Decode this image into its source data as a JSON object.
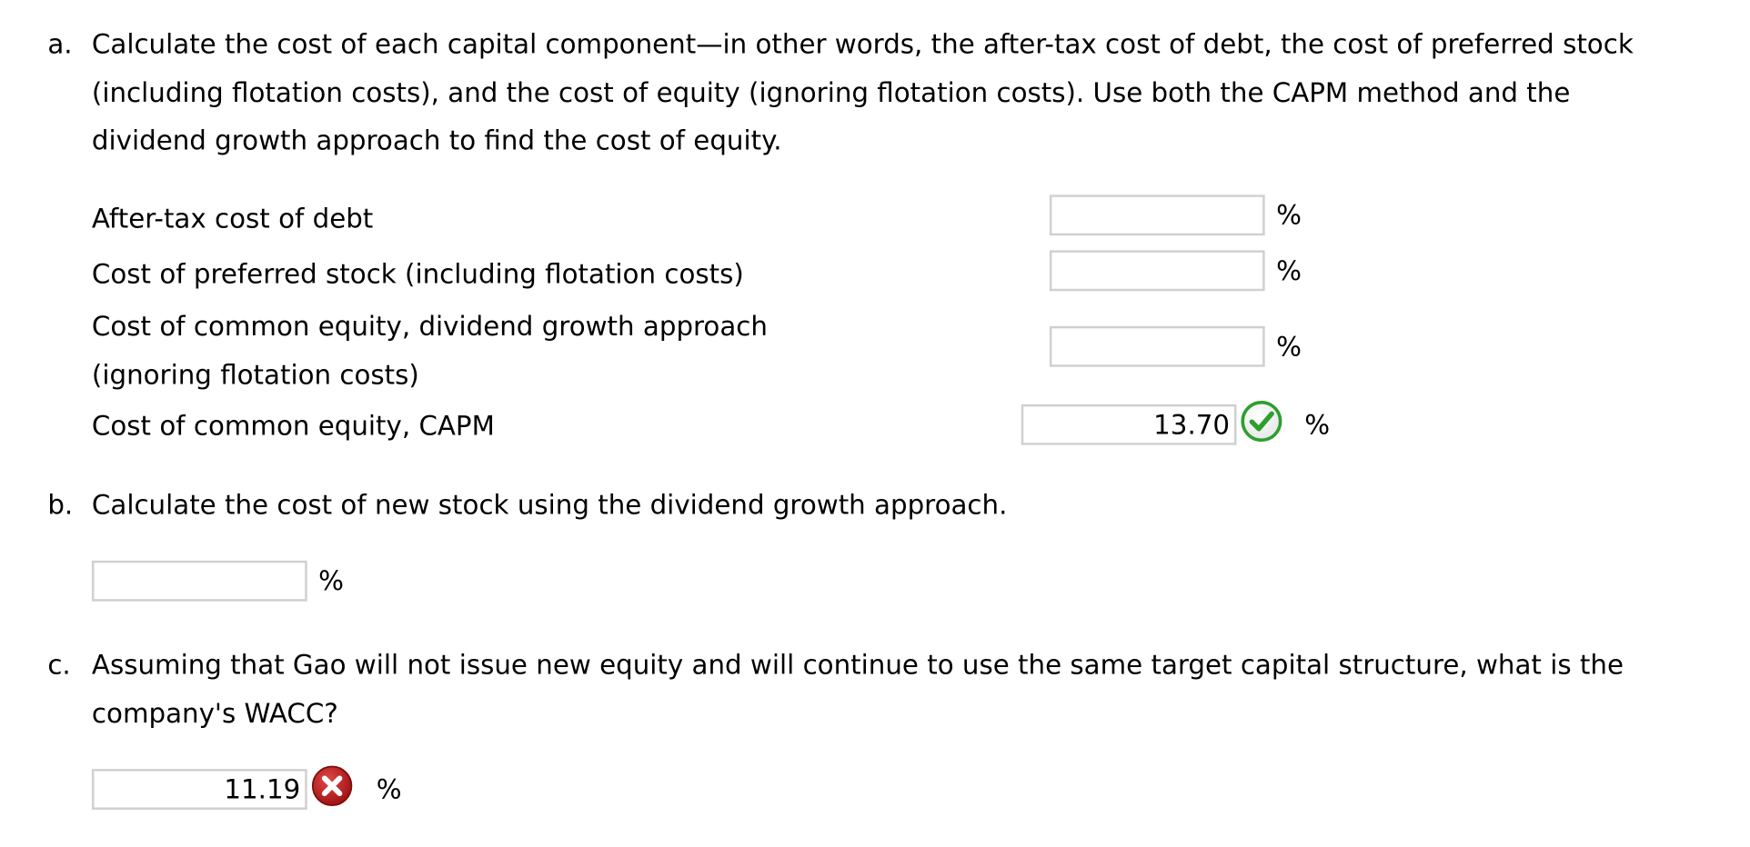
{
  "part_a": {
    "marker": "a.",
    "question_lines": [
      "Calculate the cost of each capital component—in other words, the after-tax cost of debt, the cost of preferred stock",
      "(including flotation costs), and the cost of equity (ignoring flotation costs). Use both the CAPM method and the",
      "dividend growth approach to find the cost of equity."
    ],
    "rows": [
      {
        "label_lines": [
          "After-tax cost of debt"
        ],
        "value": "",
        "unit": "%",
        "status": "none"
      },
      {
        "label_lines": [
          "Cost of preferred stock (including flotation costs)"
        ],
        "value": "",
        "unit": "%",
        "status": "none"
      },
      {
        "label_lines": [
          "Cost of common equity, dividend growth approach",
          "(ignoring flotation costs)"
        ],
        "value": "",
        "unit": "%",
        "status": "none"
      },
      {
        "label_lines": [
          "Cost of common equity, CAPM"
        ],
        "value": "13.70",
        "unit": "%",
        "status": "correct"
      }
    ]
  },
  "part_b": {
    "marker": "b.",
    "question_lines": [
      "Calculate the cost of new stock using the dividend growth approach."
    ],
    "answer": {
      "value": "",
      "unit": "%",
      "status": "none"
    }
  },
  "part_c": {
    "marker": "c.",
    "question_lines": [
      "Assuming that Gao will not issue new equity and will continue to use the same target capital structure, what is the",
      "company's WACC?"
    ],
    "answer": {
      "value": "11.19",
      "unit": "%",
      "status": "incorrect"
    }
  },
  "colors": {
    "correct_green": "#2e9e2e",
    "incorrect_red": "#b01818",
    "input_border": "#d0d0d0"
  },
  "icons": {
    "correct": "check-circle-icon",
    "incorrect": "x-circle-icon"
  }
}
